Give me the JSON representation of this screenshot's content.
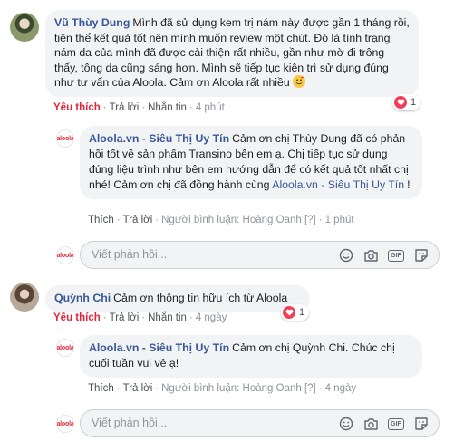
{
  "comment1": {
    "author": "Vũ Thùy Dung",
    "text": "Mình đã sử dụng kem trị nám này được gần 1 tháng rồi, tiện thể kết quả tốt nên mình muốn review một chút. Đó là tình trạng nám da của mình đã được cải thiện rất nhiều, gần như mờ đi trông thấy, tông da cũng sáng hơn. Mình sẽ tiếp tục kiên trì sử dụng đúng như tư vấn của Aloola. Cảm ơn Aloola rất nhiều",
    "like": "Yêu thích",
    "reply": "Trả lời",
    "message": "Nhắn tin",
    "time": "4 phút",
    "reactions": "1",
    "reply_item": {
      "author": "Aloola.vn - Siêu Thị Uy Tín",
      "text": "Cảm ơn chị Thùy Dung đã có phản hồi tốt về sản phẩm Transino bên em ạ. Chị tiếp tục sử dụng đúng liệu trình như bên em hướng dẫn để có kết quả tốt nhất chị nhé! Cảm ơn chị đã đồng hành cùng",
      "mention": "Aloola.vn - Siêu Thị Uy Tín",
      "end": "!",
      "like": "Thích",
      "reply": "Trả lời",
      "commenter": "Người bình luận: Hoàng Oanh",
      "flag": "[?]",
      "time": "1 phút"
    }
  },
  "comment2": {
    "author": "Quỳnh Chi",
    "text": "Cảm ơn thông tin hữu ích từ Aloola",
    "like": "Yêu thích",
    "reply": "Trả lời",
    "message": "Nhắn tin",
    "time": "4 ngày",
    "reactions": "1",
    "reply_item": {
      "author": "Aloola.vn - Siêu Thị Uy Tín",
      "text": "Cảm ơn chị Quỳnh Chi. Chúc chị cuối tuần vui vẻ ạ!",
      "like": "Thích",
      "reply": "Trả lời",
      "commenter": "Người bình luận: Hoàng Oanh",
      "flag": "[?]",
      "time": "4 ngày"
    }
  },
  "brand_avatar_text": "aloola",
  "reply_placeholder": "Viết phản hồi...",
  "icons": [
    "emoji-icon",
    "camera-icon",
    "gif-icon",
    "sticker-icon",
    "heart-reaction-icon"
  ],
  "colors": {
    "name": "#385898",
    "liked": "#e0263b",
    "bubble": "#f2f3f5",
    "heart": "#f33e58"
  }
}
